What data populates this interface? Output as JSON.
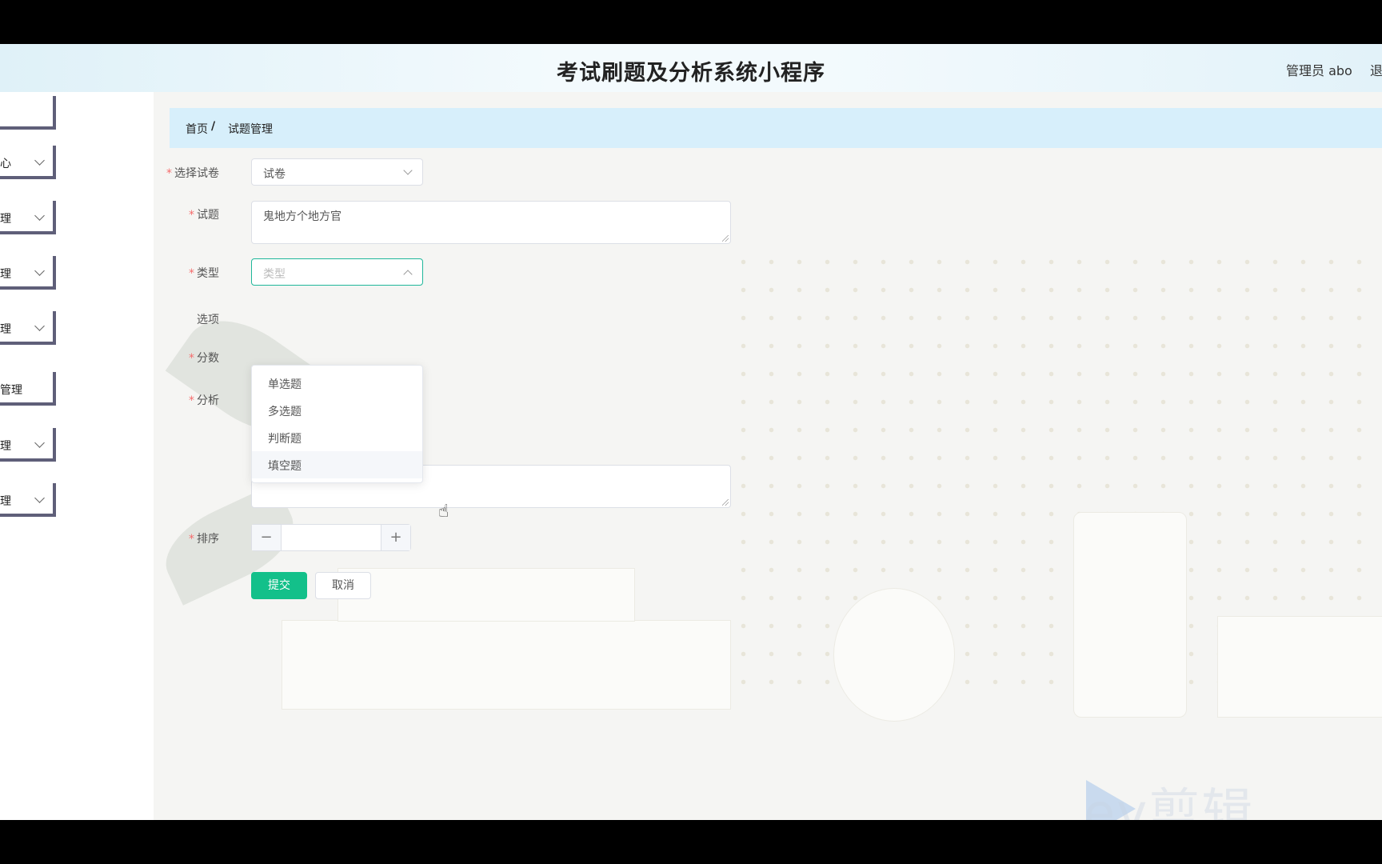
{
  "header": {
    "title": "考试刷题及分析系统小程序",
    "user": "管理员 abo",
    "logout": "退"
  },
  "sidebar": {
    "items": [
      {
        "label": "",
        "has_arrow": false
      },
      {
        "label": "心",
        "has_arrow": true
      },
      {
        "label": "理",
        "has_arrow": true
      },
      {
        "label": "理",
        "has_arrow": true
      },
      {
        "label": "理",
        "has_arrow": true
      },
      {
        "label": "管理",
        "has_arrow": false
      },
      {
        "label": "理",
        "has_arrow": true
      },
      {
        "label": "理",
        "has_arrow": true
      }
    ]
  },
  "breadcrumb": {
    "home": "首页",
    "separator": "/",
    "current": "试题管理"
  },
  "form": {
    "paper": {
      "label": "选择试卷",
      "value": "试卷"
    },
    "question": {
      "label": "试题",
      "value": "鬼地方个地方官"
    },
    "type": {
      "label": "类型",
      "placeholder": "类型"
    },
    "options": {
      "label": "选项"
    },
    "score": {
      "label": "分数"
    },
    "analysis": {
      "label": "分析",
      "value": ""
    },
    "order": {
      "label": "排序",
      "minus": "−",
      "plus": "+",
      "value": ""
    },
    "required_mark": "*",
    "submit": "提交",
    "cancel": "取消"
  },
  "type_dropdown": {
    "options": [
      "单选题",
      "多选题",
      "判断题",
      "填空题"
    ],
    "hovered": "填空题"
  },
  "watermark": "ev剪辑",
  "colors": {
    "primary": "#13c08a",
    "breadcrumb_bg": "#d7effb",
    "required": "#f56c6c",
    "sidebar_border": "#5f5f79"
  }
}
